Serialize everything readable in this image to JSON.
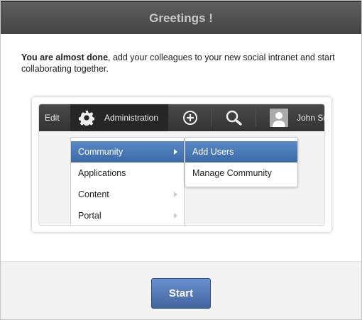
{
  "header": {
    "title": "Greetings !"
  },
  "intro": {
    "bold": "You are almost done",
    "rest": ", add your colleagues to your new social intranet and start collaborating together."
  },
  "illustration": {
    "edit": "Edit",
    "administration": "Administration",
    "user": "John Sm",
    "menu": [
      {
        "label": "Community",
        "submenu": true
      },
      {
        "label": "Applications",
        "submenu": false
      },
      {
        "label": "Content",
        "submenu": true
      },
      {
        "label": "Portal",
        "submenu": true
      }
    ],
    "submenu": [
      "Add Users",
      "Manage Community"
    ]
  },
  "footer": {
    "start": "Start"
  }
}
